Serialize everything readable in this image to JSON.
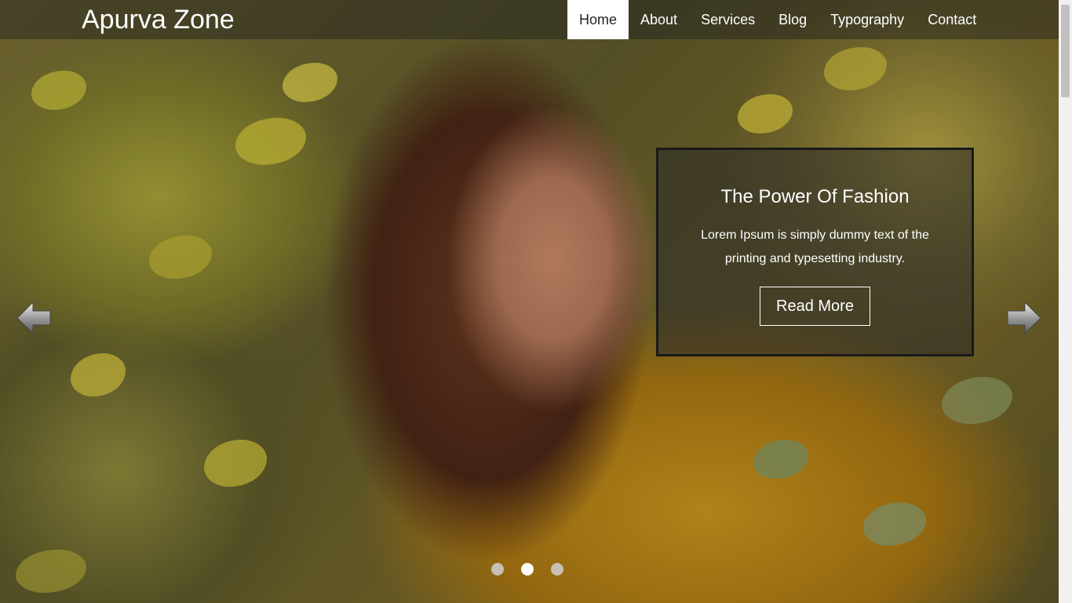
{
  "brand": {
    "name": "Apurva Zone"
  },
  "nav": {
    "items": [
      {
        "label": "Home",
        "active": true
      },
      {
        "label": "About",
        "active": false
      },
      {
        "label": "Services",
        "active": false
      },
      {
        "label": "Blog",
        "active": false
      },
      {
        "label": "Typography",
        "active": false
      },
      {
        "label": "Contact",
        "active": false
      }
    ]
  },
  "hero": {
    "title": "The Power Of Fashion",
    "text": "Lorem Ipsum is simply dummy text of the printing and typesetting industry.",
    "button_label": "Read More",
    "prev_icon": "arrow-left-icon",
    "next_icon": "arrow-right-icon",
    "slides": 3,
    "active_slide": 2
  },
  "colors": {
    "nav_active_bg": "#ffffff",
    "caption_border": "#1a1a1a"
  }
}
